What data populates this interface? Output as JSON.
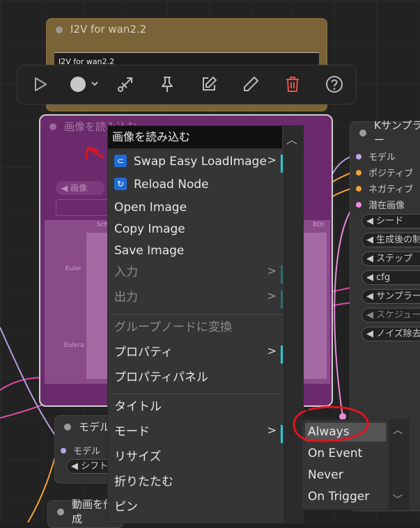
{
  "nodes": {
    "i2v": {
      "title": "I2V for wan2.2",
      "text": "I2V for wan2.2"
    },
    "load_image": {
      "title": "画像を読み込む",
      "widget": "◀ 画像",
      "labels": [
        "Euler",
        "Eulera",
        "Sched",
        "BDI"
      ]
    },
    "ksampler": {
      "title": "Kサンプラー",
      "inputs": [
        {
          "label": "モデル",
          "color": "#b9a6e8"
        },
        {
          "label": "ポジティブ",
          "color": "#f2a23a"
        },
        {
          "label": "ネガティブ",
          "color": "#f2a23a"
        },
        {
          "label": "潜在画像",
          "color": "#f08ce0"
        }
      ],
      "widgets": [
        "◀ シード",
        "◀ 生成後の制御",
        "◀ ステップ",
        "◀ cfg",
        "◀ サンプラー",
        "◀ スケジューラ",
        "◀ ノイズ除去"
      ]
    },
    "model": {
      "title": "モデル",
      "input": "モデル",
      "widget": "◀ シフト"
    },
    "video": {
      "title": "動画を作成"
    }
  },
  "toolbar": {
    "buttons": [
      "play-icon",
      "color-picker-icon",
      "bypass-icon",
      "pin-icon",
      "edit-icon",
      "pencil-icon",
      "trash-icon",
      "help-icon"
    ],
    "danger_color": "#e0554a"
  },
  "context_menu": {
    "header": "画像を読み込む",
    "items": [
      {
        "label": "Swap Easy LoadImage",
        "submenu": true,
        "icon": "swap-icon"
      },
      {
        "label": "Reload Node",
        "icon": "reload-icon"
      },
      {
        "label": "Open Image"
      },
      {
        "label": "Copy Image"
      },
      {
        "label": "Save Image"
      },
      {
        "label": "入力",
        "submenu": true,
        "disabled": true
      },
      {
        "label": "出力",
        "submenu": true,
        "disabled": true
      },
      {
        "label": "グループノードに変換",
        "disabled": true
      },
      {
        "label": "プロパティ",
        "submenu": true
      },
      {
        "label": "プロパティパネル"
      },
      {
        "label": "タイトル"
      },
      {
        "label": "モード",
        "submenu": true
      },
      {
        "label": "リサイズ"
      },
      {
        "label": "折りたたむ"
      },
      {
        "label": "ピン"
      }
    ],
    "accent_color": "#27c9d8"
  },
  "mode_submenu": {
    "items": [
      "Always",
      "On Event",
      "Never",
      "On Trigger"
    ],
    "selected": "Always"
  },
  "annotation_color": "#e0141e"
}
